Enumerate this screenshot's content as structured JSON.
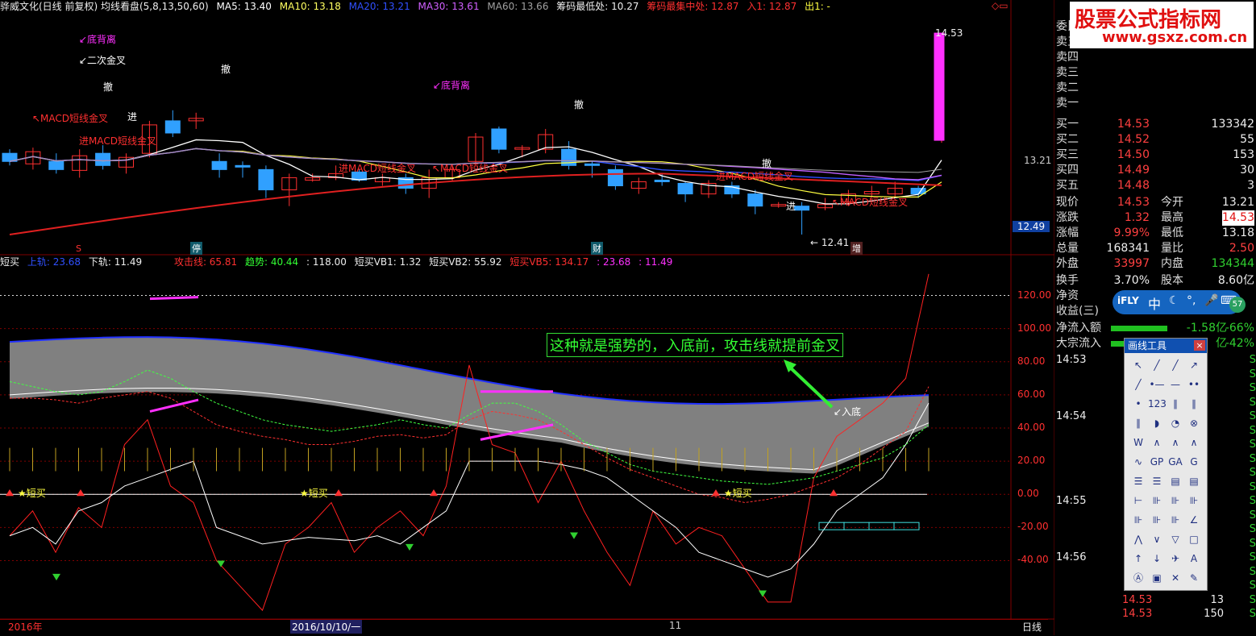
{
  "header": {
    "title": "骅威文化(日线 前复权) 均线看盘(5,8,13,50,60)",
    "ma5": "MA5: 13.40",
    "ma10": "MA10: 13.18",
    "ma20": "MA20: 13.21",
    "ma30": "MA30: 13.61",
    "ma60": "MA60: 13.66",
    "chip_low": "筹码最低处: 10.27",
    "chip_focus": "筹码最集中处: 12.87",
    "entry": "入1: 12.87",
    "exit": "出1: -",
    "corner": "◇▭"
  },
  "price_labels": {
    "high": "14.53",
    "low": "← 12.41",
    "axis_main": "13.21",
    "axis_current": "12.49"
  },
  "main_chart_text": {
    "bottom_divergence_1": "↙底背离",
    "second_golden_cross": "↙二次金叉",
    "macd_cross_1": "↖MACD短线金叉",
    "macd_cross_2": "进MACD短线金叉",
    "macd_cross_3": "进MACD短线金叉",
    "macd_cross_4": "↖MACD短线金叉",
    "macd_cross_5": "进MACD短线金叉",
    "macd_cross_6": "↖MACD短线金叉",
    "bottom_divergence_2": "↙底背离",
    "sell_1": "撤",
    "sell_2": "撤",
    "sell_3": "撤",
    "sell_4": "撤",
    "in_1": "进",
    "in_2": "进",
    "marker_s": "S",
    "marker_ting": "停",
    "marker_cai": "财",
    "marker_zeng": "增"
  },
  "indicator_header": {
    "name": "短买",
    "upper": "上轨: 23.68",
    "lower": "下轨: 11.49",
    "attack": "攻击线: 65.81",
    "trend": "趋势: 40.44",
    "v118": ": 118.00",
    "vb1": "短买VB1: 1.32",
    "vb2": "短买VB2: 55.92",
    "vb5": "短买VB5: 134.17",
    "v2368": ": 23.68",
    "v1149": ": 11.49"
  },
  "indicator_axis": [
    "120.00",
    "100.00",
    "80.00",
    "60.00",
    "40.00",
    "20.00",
    "0.00",
    "-20.00",
    "-40.00"
  ],
  "indicator_text": {
    "annotation": "这种就是强势的，入底前，攻击线就提前金叉",
    "into_bottom": "↙入底",
    "short_buy_1": "★短买",
    "short_buy_2": "★短买",
    "short_buy_3": "★短买"
  },
  "bottom_bar": {
    "year": "2016年",
    "date": "2016/10/10/一",
    "month": "11",
    "period": "日线"
  },
  "right_panel": {
    "logo_main": "股票公式指标网",
    "logo_url": "www.gsxz.com.cn",
    "orders_sell": [
      "委比",
      "卖五",
      "卖四",
      "卖三",
      "卖二",
      "卖一"
    ],
    "orders_buy": [
      {
        "label": "买一",
        "price": "14.53",
        "vol": "133342"
      },
      {
        "label": "买二",
        "price": "14.52",
        "vol": "55"
      },
      {
        "label": "买三",
        "price": "14.50",
        "vol": "153"
      },
      {
        "label": "买四",
        "price": "14.49",
        "vol": "30"
      },
      {
        "label": "买五",
        "price": "14.48",
        "vol": "3"
      }
    ],
    "stats": [
      {
        "l1": "现价",
        "v1": "14.53",
        "l2": "今开",
        "v2": "13.21",
        "c1": "red",
        "c2": "wht"
      },
      {
        "l1": "涨跌",
        "v1": "1.32",
        "l2": "最高",
        "v2": "14.53",
        "c1": "red",
        "c2": "red"
      },
      {
        "l1": "涨幅",
        "v1": "9.99%",
        "l2": "最低",
        "v2": "13.18",
        "c1": "red",
        "c2": "wht"
      },
      {
        "l1": "总量",
        "v1": "168341",
        "l2": "量比",
        "v2": "2.50",
        "c1": "wht",
        "c2": "red"
      },
      {
        "l1": "外盘",
        "v1": "33997",
        "l2": "内盘",
        "v2": "134344",
        "c1": "red",
        "c2": "grn"
      }
    ],
    "stats2": [
      {
        "l1": "换手",
        "v1": "3.70%",
        "l2": "股本",
        "v2": "8.60亿"
      },
      {
        "l1": "净资",
        "v1": "",
        "l2": "",
        "v2": ""
      },
      {
        "l1": "收益(三)",
        "v1": "",
        "l2": "",
        "v2": ""
      }
    ],
    "flow": [
      {
        "label": "净流入额",
        "value": "-1.58亿",
        "pct": "-66%"
      },
      {
        "label": "大宗流入",
        "value": "亿",
        "pct": "-42%"
      }
    ],
    "ifly": {
      "brand": "iFLY",
      "lang": "中",
      "badge": "57"
    },
    "ticks": [
      {
        "time": "14:53",
        "s": "S"
      },
      {
        "time": "",
        "s": "S"
      },
      {
        "time": "",
        "s": "S"
      },
      {
        "time": "",
        "s": "S"
      },
      {
        "time": "14:54",
        "s": "S"
      },
      {
        "time": "",
        "s": "S"
      },
      {
        "time": "",
        "s": "S"
      },
      {
        "time": "",
        "s": "S"
      },
      {
        "time": "",
        "s": "S"
      },
      {
        "time": "",
        "s": "S"
      },
      {
        "time": "14:55",
        "s": "S"
      },
      {
        "time": "",
        "s": "S"
      },
      {
        "time": "",
        "s": "S"
      },
      {
        "time": "",
        "s": "S"
      },
      {
        "time": "14:56",
        "s": "S"
      },
      {
        "time": "",
        "s": "S"
      },
      {
        "time": "",
        "s": "S"
      },
      {
        "time": "",
        "price": "14.53",
        "vol": "13",
        "s": "S"
      },
      {
        "time": "",
        "price": "14.53",
        "vol": "150",
        "s": "S"
      }
    ]
  },
  "draw_tools": {
    "title": "画线工具",
    "close": "×",
    "tools": [
      "↖",
      "╱",
      "╱",
      "↗",
      "╱",
      "•—",
      "—",
      "••",
      "•",
      "123",
      "∥",
      "∥",
      "∥",
      "◗",
      "◔",
      "⊗",
      "W",
      "∧",
      "∧",
      "∧",
      "∿",
      "GP",
      "GA",
      "G",
      "☰",
      "☰",
      "▤",
      "▤",
      "⊢",
      "⊪",
      "⊪",
      "⊪",
      "⊪",
      "⊪",
      "⊪",
      "∠",
      "⋀",
      "∨",
      "▽",
      "□",
      "↑",
      "↓",
      "✈",
      "A",
      "Ⓐ",
      "▣",
      "✕",
      "✎",
      "▤",
      "▭",
      "▣"
    ]
  },
  "colors": {
    "up": "#ff3030",
    "down": "#30a0ff",
    "ma5": "#ffffff",
    "ma10": "#ffff40",
    "ma20": "#3050ff",
    "ma30": "#c060ff",
    "ma60": "#a0a0a0",
    "red_line": "#e02020",
    "magenta": "#ff30ff"
  },
  "candles": [
    {
      "o": 13.05,
      "c": 12.95,
      "h": 13.1,
      "l": 12.9
    },
    {
      "o": 12.92,
      "c": 13.07,
      "h": 13.12,
      "l": 12.85
    },
    {
      "o": 12.95,
      "c": 12.85,
      "h": 13.05,
      "l": 12.8
    },
    {
      "o": 12.84,
      "c": 13.02,
      "h": 13.1,
      "l": 12.75
    },
    {
      "o": 13.05,
      "c": 12.9,
      "h": 13.15,
      "l": 12.85
    },
    {
      "o": 12.88,
      "c": 13.0,
      "h": 13.05,
      "l": 12.8
    },
    {
      "o": 13.05,
      "c": 13.4,
      "h": 13.45,
      "l": 13.0
    },
    {
      "o": 13.45,
      "c": 13.3,
      "h": 13.58,
      "l": 13.25
    },
    {
      "o": 13.45,
      "c": 13.48,
      "h": 13.55,
      "l": 13.35
    },
    {
      "o": 12.95,
      "c": 12.85,
      "h": 13.05,
      "l": 12.75
    },
    {
      "o": 12.9,
      "c": 12.89,
      "h": 12.95,
      "l": 12.75
    },
    {
      "o": 12.85,
      "c": 12.6,
      "h": 12.9,
      "l": 12.5
    },
    {
      "o": 12.6,
      "c": 12.75,
      "h": 12.8,
      "l": 12.4
    },
    {
      "o": 12.72,
      "c": 12.75,
      "h": 12.8,
      "l": 12.7
    },
    {
      "o": 12.75,
      "c": 12.8,
      "h": 12.9,
      "l": 12.72
    },
    {
      "o": 12.82,
      "c": 12.72,
      "h": 12.85,
      "l": 12.7
    },
    {
      "o": 12.7,
      "c": 12.75,
      "h": 12.8,
      "l": 12.65
    },
    {
      "o": 12.75,
      "c": 12.62,
      "h": 12.8,
      "l": 12.55
    },
    {
      "o": 12.62,
      "c": 12.75,
      "h": 12.85,
      "l": 12.5
    },
    {
      "o": 12.75,
      "c": 12.85,
      "h": 12.9,
      "l": 12.7
    },
    {
      "o": 12.95,
      "c": 13.25,
      "h": 13.3,
      "l": 12.9
    },
    {
      "o": 13.35,
      "c": 13.1,
      "h": 13.38,
      "l": 13.05
    },
    {
      "o": 13.1,
      "c": 13.12,
      "h": 13.15,
      "l": 13.0
    },
    {
      "o": 13.1,
      "c": 13.28,
      "h": 13.35,
      "l": 13.05
    },
    {
      "o": 13.1,
      "c": 12.9,
      "h": 13.2,
      "l": 12.85
    },
    {
      "o": 12.92,
      "c": 12.91,
      "h": 12.95,
      "l": 12.75
    },
    {
      "o": 12.85,
      "c": 12.65,
      "h": 12.9,
      "l": 12.6
    },
    {
      "o": 12.62,
      "c": 12.7,
      "h": 12.75,
      "l": 12.55
    },
    {
      "o": 12.72,
      "c": 12.7,
      "h": 12.8,
      "l": 12.65
    },
    {
      "o": 12.68,
      "c": 12.55,
      "h": 12.7,
      "l": 12.45
    },
    {
      "o": 12.55,
      "c": 12.68,
      "h": 12.72,
      "l": 12.5
    },
    {
      "o": 12.65,
      "c": 12.55,
      "h": 12.7,
      "l": 12.5
    },
    {
      "o": 12.55,
      "c": 12.4,
      "h": 12.6,
      "l": 12.3
    },
    {
      "o": 12.42,
      "c": 12.42,
      "h": 12.45,
      "l": 12.38
    },
    {
      "o": 12.4,
      "c": 12.35,
      "h": 12.45,
      "l": 12.05
    },
    {
      "o": 12.38,
      "c": 12.42,
      "h": 12.5,
      "l": 12.35
    },
    {
      "o": 12.45,
      "c": 12.55,
      "h": 12.6,
      "l": 12.4
    },
    {
      "o": 12.55,
      "c": 12.58,
      "h": 12.65,
      "l": 12.5
    },
    {
      "o": 12.55,
      "c": 12.62,
      "h": 12.7,
      "l": 12.5
    },
    {
      "o": 12.62,
      "c": 12.55,
      "h": 12.65,
      "l": 12.5
    },
    {
      "o": 13.21,
      "c": 14.53,
      "h": 14.53,
      "l": 13.18
    }
  ]
}
